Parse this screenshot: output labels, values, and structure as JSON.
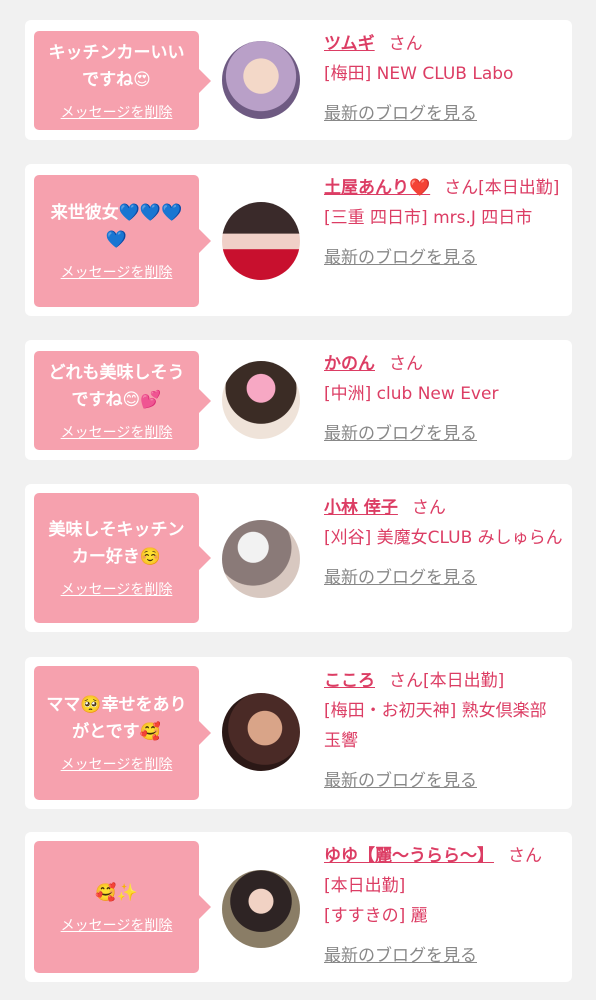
{
  "items": [
    {
      "message": "キッチンカーいいですね😍",
      "delete_label": "メッセージを削除",
      "name": "ツムギ",
      "honorific": "さん",
      "status": "",
      "shop": "[梅田] NEW CLUB Labo",
      "blog_label": "最新のブログを見る"
    },
    {
      "message": "来世彼女💙💙💙💙",
      "delete_label": "メッセージを削除",
      "name": "土屋あんり❤️",
      "honorific": "さん",
      "status": "[本日出勤]",
      "shop": "[三重 四日市] mrs.J 四日市",
      "blog_label": "最新のブログを見る"
    },
    {
      "message": "どれも美味しそうですね😊💕",
      "delete_label": "メッセージを削除",
      "name": "かのん",
      "honorific": "さん",
      "status": "",
      "shop": "[中洲] club New Ever",
      "blog_label": "最新のブログを見る"
    },
    {
      "message": "美味しそキッチンカー好き☺️",
      "delete_label": "メッセージを削除",
      "name": "小林 倖子",
      "honorific": "さん",
      "status": "",
      "shop": "[刈谷] 美魔女CLUB みしゅらん",
      "blog_label": "最新のブログを見る"
    },
    {
      "message": "ママ🥺幸せをありがとです🥰",
      "delete_label": "メッセージを削除",
      "name": "こころ",
      "honorific": "さん",
      "status": "[本日出勤]",
      "shop": "[梅田・お初天神] 熟女倶楽部 玉響",
      "blog_label": "最新のブログを見る"
    },
    {
      "message": "🥰✨",
      "delete_label": "メッセージを削除",
      "name": "ゆゆ【麗〜うらら〜】",
      "honorific": "さん",
      "status": "[本日出勤]",
      "shop": "[すすきの] 麗",
      "blog_label": "最新のブログを見る"
    }
  ]
}
